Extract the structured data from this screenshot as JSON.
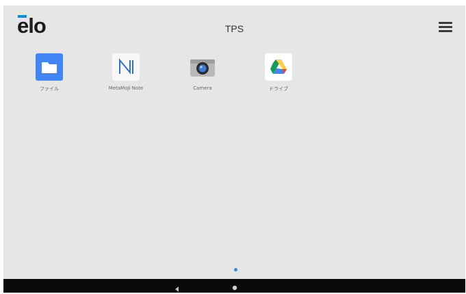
{
  "header": {
    "logo_text": "elo",
    "title": "TPS",
    "menu_icon": "hamburger-menu-icon"
  },
  "apps": [
    {
      "label": "ファイル",
      "icon": "files-folder-icon",
      "color": "#4285f4"
    },
    {
      "label": "MetaMoJi Note",
      "icon": "metamoji-note-icon",
      "color": "#2f6fd6"
    },
    {
      "label": "Camera",
      "icon": "camera-icon",
      "color": "#3a7bd5"
    },
    {
      "label": "ドライブ",
      "icon": "google-drive-icon",
      "color": "#34a853"
    }
  ],
  "page_indicator": {
    "current": 1,
    "total": 1,
    "color": "#2f8de4"
  },
  "navbar": {
    "back_icon": "back-triangle-icon",
    "home_icon": "home-circle-icon"
  },
  "colors": {
    "background": "#e6e6e6",
    "navbar": "#0a0a0a",
    "logo_accent": "#0e8fd6"
  }
}
